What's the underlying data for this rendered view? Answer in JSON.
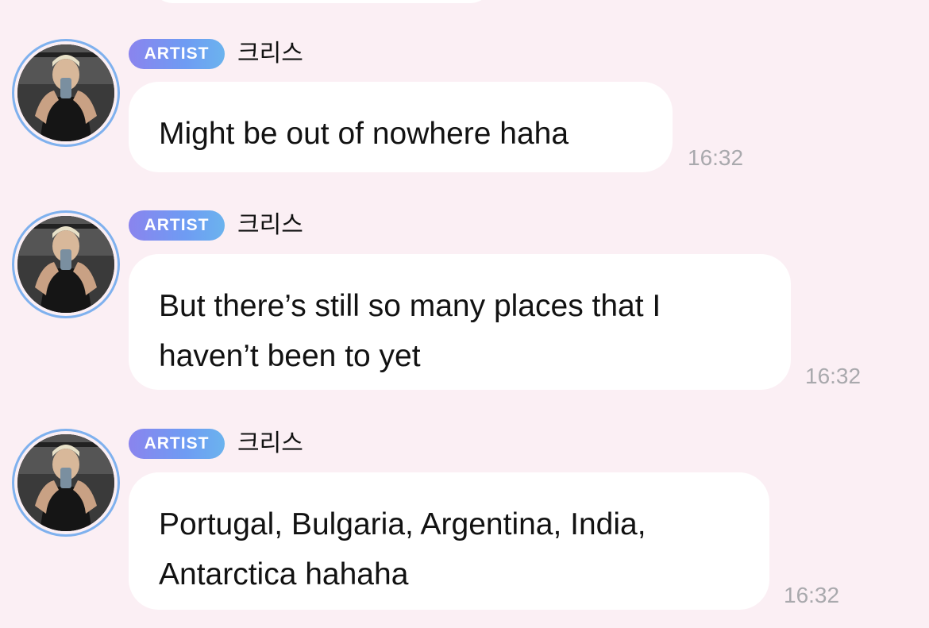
{
  "messages": [
    {
      "badge": "ARTIST",
      "sender": "크리스",
      "lines": [
        "Might be out of nowhere haha"
      ],
      "time": "16:32"
    },
    {
      "badge": "ARTIST",
      "sender": "크리스",
      "lines": [
        "But there’s still so many places that I",
        "haven’t been to yet"
      ],
      "time": "16:32"
    },
    {
      "badge": "ARTIST",
      "sender": "크리스",
      "lines": [
        "Portugal, Bulgaria, Argentina, India,",
        "Antarctica hahaha"
      ],
      "time": "16:32"
    }
  ],
  "colors": {
    "background": "#fbeff4",
    "bubble": "#ffffff",
    "badge_gradient_start": "#8a84ee",
    "badge_gradient_end": "#6bb3ee",
    "avatar_ring": "#7fb1ee",
    "timestamp": "#a9a9ad"
  },
  "icons": {
    "avatar": "profile-photo"
  }
}
